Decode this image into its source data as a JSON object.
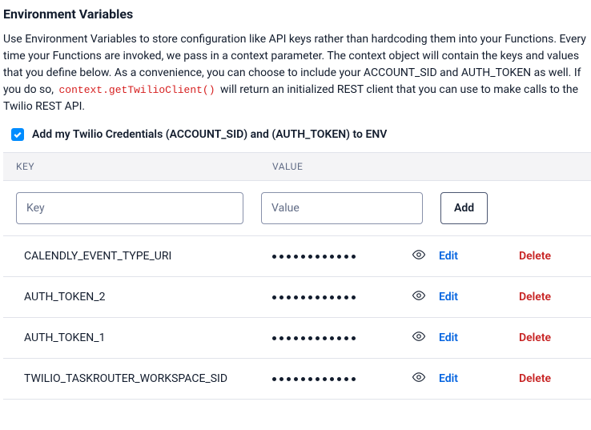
{
  "title": "Environment Variables",
  "description": {
    "part1": "Use Environment Variables to store configuration like API keys rather than hardcoding them into your Functions. Every time your Functions are invoked, we pass in a context parameter. The context object will contain the keys and values that you define below. As a convenience, you can choose to include your ACCOUNT_SID and AUTH_TOKEN as well. If you do so, ",
    "code": "context.getTwilioClient()",
    "part2": " will return an initialized REST client that you can use to make calls to the Twilio REST API."
  },
  "checkbox": {
    "checked": true,
    "label": "Add my Twilio Credentials (ACCOUNT_SID) and (AUTH_TOKEN) to ENV"
  },
  "columns": {
    "key": "KEY",
    "value": "VALUE"
  },
  "add": {
    "key_placeholder": "Key",
    "value_placeholder": "Value",
    "button": "Add"
  },
  "actions": {
    "edit": "Edit",
    "delete": "Delete"
  },
  "rows": [
    {
      "key": "CALENDLY_EVENT_TYPE_URI",
      "dots": 12
    },
    {
      "key": "AUTH_TOKEN_2",
      "dots": 12
    },
    {
      "key": "AUTH_TOKEN_1",
      "dots": 12
    },
    {
      "key": "TWILIO_TASKROUTER_WORKSPACE_SID",
      "dots": 12
    }
  ]
}
